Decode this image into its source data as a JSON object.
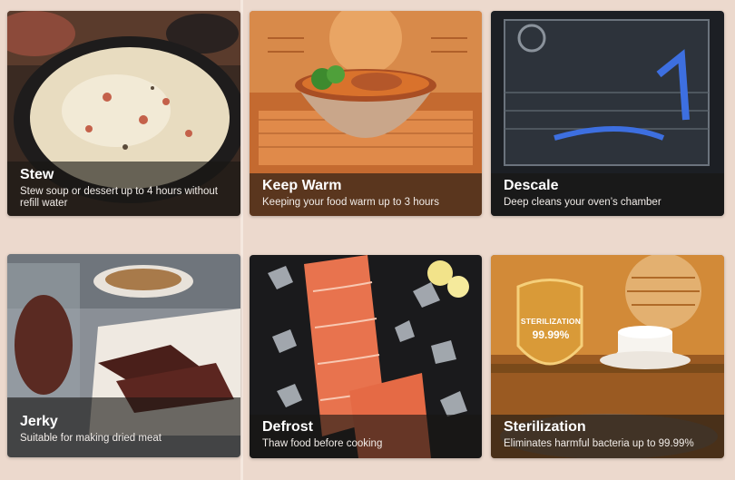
{
  "features": [
    {
      "title": "Stew",
      "description": "Stew soup or dessert up to 4 hours without refill water",
      "icon": "stew-pot-image"
    },
    {
      "title": "Keep Warm",
      "description": "Keeping your food warm up to 3 hours",
      "icon": "warm-bowl-image"
    },
    {
      "title": "Descale",
      "description": "Deep cleans your oven’s chamber",
      "icon": "oven-chamber-image"
    },
    {
      "title": "Jerky",
      "description": "Suitable for making dried meat",
      "icon": "jerky-image"
    },
    {
      "title": "Defrost",
      "description": "Thaw food before cooking",
      "icon": "salmon-ice-image"
    },
    {
      "title": "Sterilization",
      "description": "Eliminates harmful bacteria up to 99.99%",
      "icon": "sterilization-shield-image"
    }
  ],
  "badge": {
    "line1": "STERILIZATION",
    "line2": "99.99%"
  }
}
